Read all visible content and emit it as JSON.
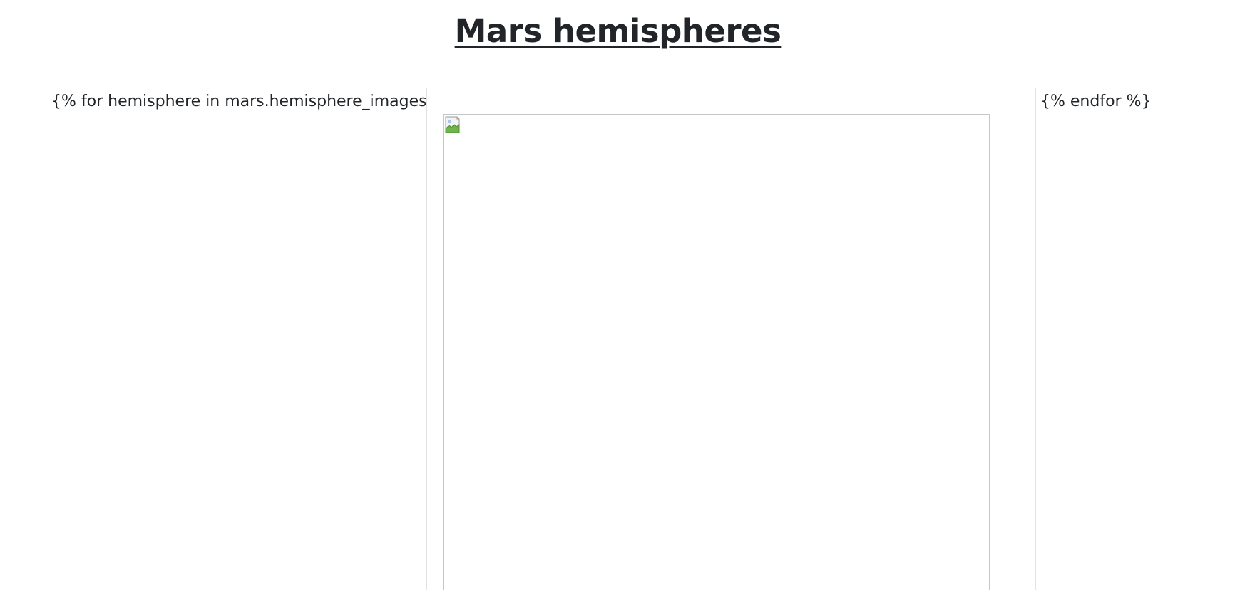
{
  "page": {
    "title": "Mars hemispheres"
  },
  "template": {
    "for_tag": "{% for hemisphere in mars.hemisphere_images %}",
    "endfor_tag": "{% endfor %}"
  },
  "thumbnail": {
    "image_state": "broken-image",
    "icon": "broken-image-icon"
  }
}
